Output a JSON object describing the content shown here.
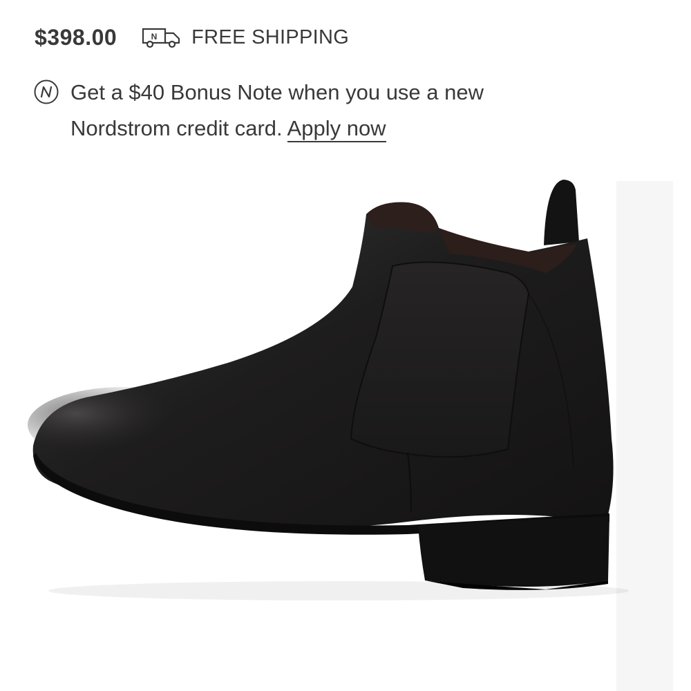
{
  "product": {
    "price": "$398.00",
    "shipping_label": "FREE SHIPPING",
    "shipping_icon": "delivery-truck-icon",
    "image_alt": "black leather chelsea boot"
  },
  "promo": {
    "icon": "nordstrom-note-icon",
    "line1": "Get a $40 Bonus Note when you use a new",
    "line2": "Nordstrom credit card.",
    "link_label": "Apply now"
  },
  "colors": {
    "text": "#393939",
    "background": "#ffffff",
    "strip": "#f6f6f6",
    "boot": "#1c1b1b"
  }
}
